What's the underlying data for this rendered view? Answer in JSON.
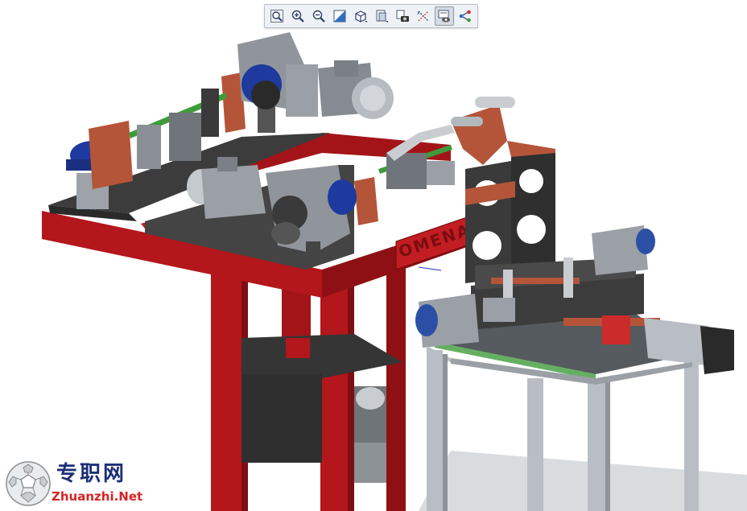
{
  "viewer": {
    "toolbar": {
      "buttons": [
        {
          "name": "zoom-fit",
          "icon": "zoom-fit-icon"
        },
        {
          "name": "zoom-in",
          "icon": "zoom-in-icon"
        },
        {
          "name": "zoom-out",
          "icon": "zoom-out-icon"
        },
        {
          "name": "zoom-window",
          "icon": "zoom-window-icon"
        },
        {
          "name": "view-orientation",
          "icon": "cube-view-icon"
        },
        {
          "name": "display-style",
          "icon": "display-style-icon"
        },
        {
          "name": "capture",
          "icon": "camera-icon"
        },
        {
          "name": "section",
          "icon": "section-icon"
        },
        {
          "name": "view-selection",
          "icon": "view-selection-icon",
          "active": true
        },
        {
          "name": "explode",
          "icon": "explode-icon"
        }
      ]
    },
    "model": {
      "frame_label": "OMENA",
      "colors": {
        "frame_red": "#b3161b",
        "plate_dark": "#3c3c3c",
        "bracket_copper": "#b4553a",
        "motor_gray": "#9aa0a6",
        "bearing_blue": "#1e3a9e",
        "shaft_green": "#3f9b3a",
        "stand_gray": "#b9bec4",
        "servo_black": "#2a2a2a"
      }
    },
    "watermark": {
      "logo_text": "专职网",
      "url": "Zhuanzhi.Net"
    }
  }
}
